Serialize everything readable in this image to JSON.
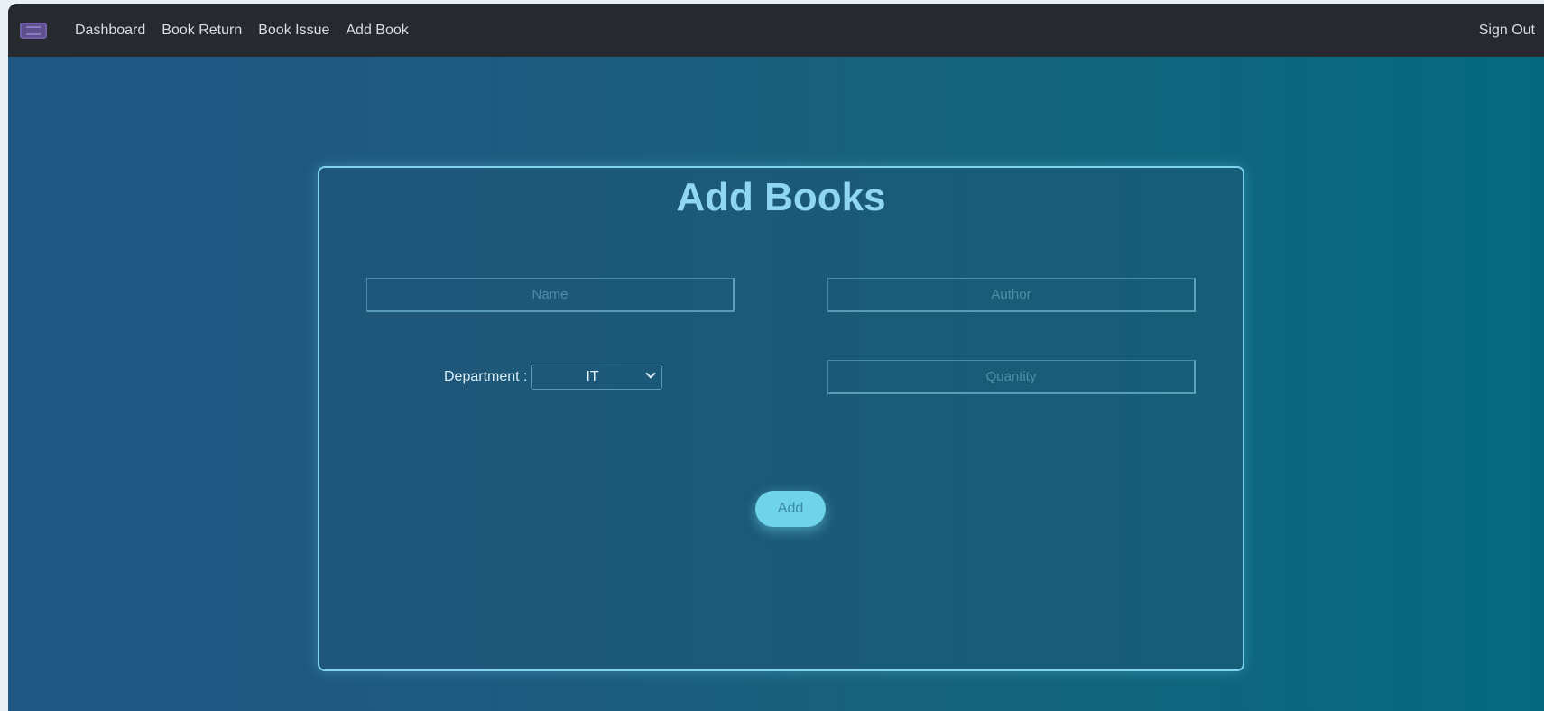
{
  "nav": {
    "items": [
      {
        "label": "Dashboard"
      },
      {
        "label": "Book Return"
      },
      {
        "label": "Book Issue"
      },
      {
        "label": "Add Book"
      }
    ],
    "sign_out_label": "Sign Out"
  },
  "form": {
    "title": "Add Books",
    "name_placeholder": "Name",
    "author_placeholder": "Author",
    "department_label": "Department :",
    "department_value": "IT",
    "quantity_placeholder": "Quantity",
    "add_button_label": "Add"
  },
  "colors": {
    "navbar": "#262a2f",
    "card_border": "#7fd3ef",
    "title": "#8fd6f3",
    "button": "#6fd3ea"
  }
}
